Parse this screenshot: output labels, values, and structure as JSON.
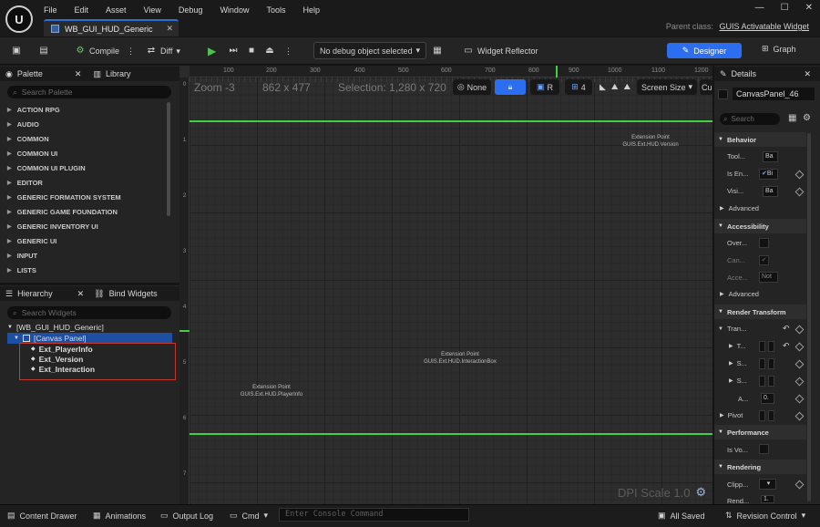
{
  "menu": [
    "File",
    "Edit",
    "Asset",
    "View",
    "Debug",
    "Window",
    "Tools",
    "Help"
  ],
  "document_tab": "WB_GUI_HUD_Generic",
  "parent_class": {
    "label": "Parent class:",
    "value": "GUIS Activatable Widget"
  },
  "toolbar": {
    "compile": "Compile",
    "diff": "Diff",
    "debug_object": "No debug object selected",
    "widget_reflector": "Widget Reflector",
    "designer": "Designer",
    "graph": "Graph"
  },
  "palette": {
    "tab": "Palette",
    "library_tab": "Library",
    "search_placeholder": "Search Palette",
    "categories": [
      "ACTION RPG",
      "AUDIO",
      "COMMON",
      "COMMON UI",
      "COMMON UI PLUGIN",
      "EDITOR",
      "GENERIC FORMATION SYSTEM",
      "GENERIC GAME FOUNDATION",
      "GENERIC INVENTORY UI",
      "GENERIC UI",
      "INPUT",
      "LISTS"
    ]
  },
  "hierarchy": {
    "tab": "Hierarchy",
    "bind_tab": "Bind Widgets",
    "search_placeholder": "Search Widgets",
    "root": "[WB_GUI_HUD_Generic]",
    "canvas": "[Canvas Panel]",
    "children": [
      "Ext_PlayerInfo",
      "Ext_Version",
      "Ext_Interaction"
    ]
  },
  "viewport": {
    "zoom": "Zoom -3",
    "size": "862 x 477",
    "selection": "Selection: 1,280 x 720",
    "none_btn": "None",
    "r_btn": "R",
    "grid_num": "4",
    "screen_size": "Screen Size",
    "cu": "Cu",
    "ruler_top": [
      "100",
      "200",
      "300",
      "400",
      "500",
      "600",
      "700",
      "800",
      "900",
      "1000",
      "1100",
      "1200"
    ],
    "dpi": "DPI Scale 1.0",
    "ext_version": [
      "Extension Point",
      "GUIS.Ext.HUD.Version"
    ],
    "ext_interaction": [
      "Extension Point",
      "GUIS.Ext.HUD.InteractionBox"
    ],
    "ext_playerinfo": [
      "Extension Point",
      "GUIS.Ext.HUD.PlayerInfo"
    ]
  },
  "details": {
    "tab": "Details",
    "name": "CanvasPanel_46",
    "search_placeholder": "Search",
    "sections": {
      "behavior": "Behavior",
      "accessibility": "Accessibility",
      "render_transform": "Render Transform",
      "performance": "Performance",
      "rendering": "Rendering"
    },
    "props": {
      "tool": "Tool...",
      "tool_val": "Ba",
      "is_en": "Is En...",
      "is_en_val": "Bi",
      "visi": "Visi...",
      "visi_val": "Ba",
      "advanced": "Advanced",
      "over": "Over...",
      "can": "Can...",
      "acce": "Acce...",
      "acce_val": "Not",
      "tran": "Tran...",
      "t": "T...",
      "s1": "S...",
      "s2": "S...",
      "a": "A...",
      "a_val": "0.",
      "pivot": "Pivot",
      "is_vo": "Is Vo...",
      "clipp": "Clipp...",
      "rend": "Rend...",
      "rend_val": "1."
    }
  },
  "status": {
    "content_drawer": "Content Drawer",
    "animations": "Animations",
    "output_log": "Output Log",
    "cmd": "Cmd",
    "console_placeholder": "Enter Console Command",
    "all_saved": "All Saved",
    "revision_control": "Revision Control"
  }
}
